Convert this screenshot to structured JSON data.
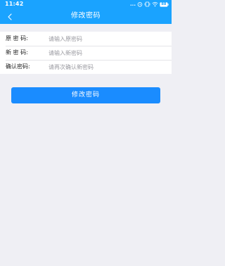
{
  "status_bar": {
    "time": "11:42",
    "dots": "...",
    "battery_level": "88",
    "icons": [
      "alarm-icon",
      "vibrate-icon",
      "wifi-icon",
      "battery-icon"
    ]
  },
  "nav": {
    "back_icon": "chevron-left-icon",
    "title": "修改密码"
  },
  "form": {
    "fields": [
      {
        "label": "原 密 码:",
        "placeholder": "请输入原密码",
        "value": ""
      },
      {
        "label": "新 密 码:",
        "placeholder": "请输入新密码",
        "value": ""
      },
      {
        "label": "确认密码:",
        "placeholder": "请再次确认新密码",
        "value": ""
      }
    ]
  },
  "submit": {
    "label": "修改密码"
  },
  "colors": {
    "header_bg": "#1aa3ff",
    "button_bg": "#1a8cff",
    "page_bg": "#efeff4"
  }
}
